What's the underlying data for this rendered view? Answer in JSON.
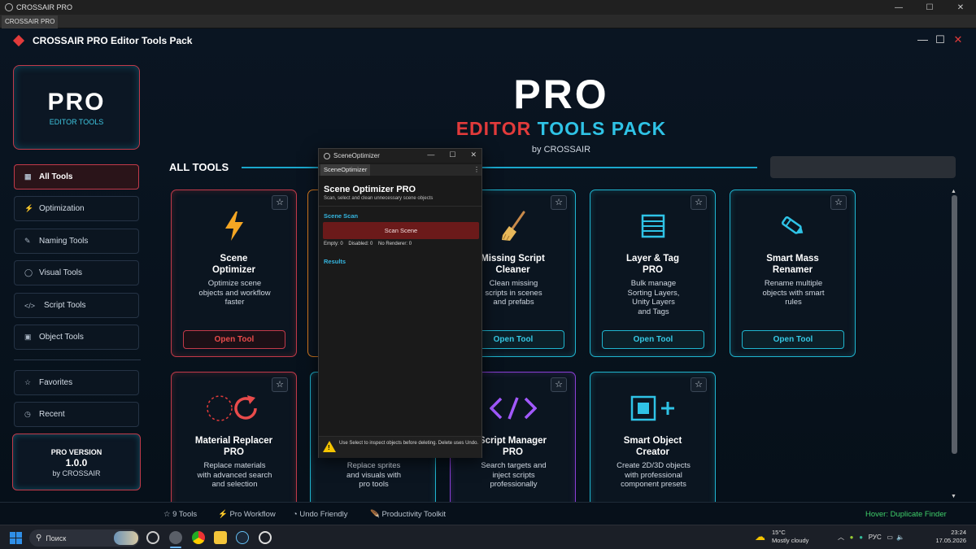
{
  "os": {
    "window_title": "CROSSAIR PRO",
    "tab_label": "CROSSAIR PRO"
  },
  "header": {
    "title": "CROSSAIR PRO Editor Tools Pack"
  },
  "logo": {
    "big": "PRO",
    "small": "EDITOR TOOLS"
  },
  "sidebar": {
    "items": [
      {
        "icon": "▦",
        "label": "All Tools",
        "active": true
      },
      {
        "icon": "⚡",
        "label": "Optimization"
      },
      {
        "icon": "✎",
        "label": "Naming Tools"
      },
      {
        "icon": "◯",
        "label": "Visual Tools"
      },
      {
        "icon": "</>",
        "label": "Script Tools"
      },
      {
        "icon": "▣",
        "label": "Object Tools"
      },
      {
        "icon": "☆",
        "label": "Favorites"
      },
      {
        "icon": "◷",
        "label": "Recent"
      }
    ],
    "version": {
      "label": "PRO VERSION",
      "number": "1.0.0",
      "by": "by CROSSAIR"
    }
  },
  "hero": {
    "title": "PRO",
    "sub_a": "EDITOR",
    "sub_b": "TOOLS",
    "sub_c": "PACK",
    "by": "by CROSSAIR"
  },
  "section": {
    "title": "ALL TOOLS"
  },
  "cards": [
    {
      "title_1": "Scene",
      "title_2": "Optimizer",
      "desc": [
        "Optimize scene",
        "objects and workflow",
        "faster"
      ],
      "button": "Open Tool",
      "star": "☆",
      "icon": "lightning-icon"
    },
    {
      "title_1": "Missing Script",
      "title_2": "Cleaner",
      "desc": [
        "Clean missing",
        "scripts in scenes",
        "and prefabs"
      ],
      "button": "Open Tool",
      "star": "☆",
      "icon": "broom-icon"
    },
    {
      "title_1": "Layer & Tag",
      "title_2": "PRO",
      "desc": [
        "Bulk manage",
        "Sorting Layers,",
        "Unity Layers",
        "and Tags"
      ],
      "button": "Open Tool",
      "star": "☆",
      "icon": "layers-icon"
    },
    {
      "title_1": "Smart Mass",
      "title_2": "Renamer",
      "desc": [
        "Rename multiple",
        "objects with smart",
        "rules"
      ],
      "button": "Open Tool",
      "star": "☆",
      "icon": "pencil-icon"
    },
    {
      "title_1": "Material Replacer",
      "title_2": "PRO",
      "desc": [
        "Replace materials",
        "with advanced search",
        "and selection"
      ],
      "star": "☆",
      "icon": "replace-icon"
    },
    {
      "desc": [
        "Replace sprites",
        "and visuals with",
        "pro tools"
      ],
      "star": "☆"
    },
    {
      "title_1": "Script Manager",
      "title_2": "PRO",
      "desc": [
        "Search targets and",
        "inject scripts",
        "professionally"
      ],
      "star": "☆",
      "icon": "code-icon"
    },
    {
      "title_1": "Smart Object",
      "title_2": "Creator",
      "desc": [
        "Create 2D/3D objects",
        "with professional",
        "component presets"
      ],
      "star": "☆",
      "icon": "add-object-icon"
    }
  ],
  "status": {
    "tools": "☆  9 Tools",
    "workflow": "⚡  Pro Workflow",
    "undo": "◔  Undo Friendly",
    "productivity": "🪶  Productivity Toolkit",
    "hover": "Hover: Duplicate Finder"
  },
  "float": {
    "window_title": "SceneOptimizer",
    "tab": "SceneOptimizer",
    "kebab": "⋮",
    "heading": "Scene Optimizer PRO",
    "subheading": "Scan, select and clean unnecessary scene objects",
    "scan_label": "Scene Scan",
    "scan_button": "Scan Scene",
    "stats": "Empty: 0    Disabled: 0    No Renderer: 0",
    "results": "Results",
    "warning": "Use Select to inspect objects before deleting. Delete uses Undo."
  },
  "taskbar": {
    "search": "Поиск",
    "temp": "15°C",
    "weather": "Mostly cloudy",
    "lang": "РУС",
    "time": "23:24",
    "date": "17.05.2026"
  },
  "colors": {
    "accent_red": "#e23b3b",
    "accent_cyan": "#1fb5cf",
    "accent_purple": "#8a3fd6"
  }
}
